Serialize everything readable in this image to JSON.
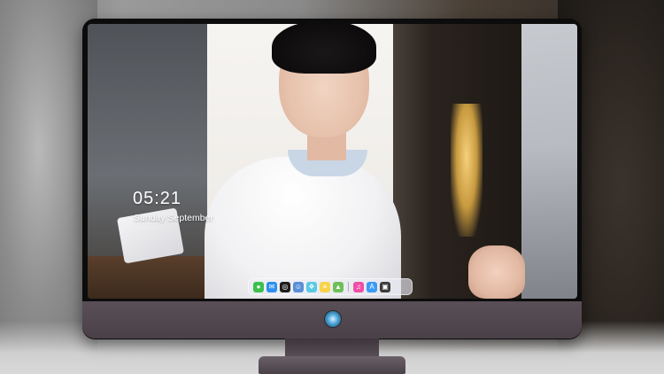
{
  "lock_screen": {
    "time": "05:21",
    "date": "Sunday September",
    "subtitle": "········ ········"
  },
  "dock": {
    "apps": [
      {
        "id": "messages",
        "icon": "messages-icon",
        "color": "#3bc04b",
        "glyph": "●"
      },
      {
        "id": "mail",
        "icon": "mail-icon",
        "color": "#2d8ff0",
        "glyph": "✉"
      },
      {
        "id": "safari",
        "icon": "safari-icon",
        "color": "#1c1c1c",
        "glyph": "◎"
      },
      {
        "id": "finder",
        "icon": "finder-icon",
        "color": "#5a8fd6",
        "glyph": "☺"
      },
      {
        "id": "photos",
        "icon": "photos-icon",
        "color": "#59c9e6",
        "glyph": "❖"
      },
      {
        "id": "notes",
        "icon": "notes-icon",
        "color": "#f6d34a",
        "glyph": "≡"
      },
      {
        "id": "maps",
        "icon": "maps-icon",
        "color": "#6fbf58",
        "glyph": "▲"
      },
      {
        "id": "music",
        "icon": "music-icon",
        "color": "#f04fa6",
        "glyph": "♫"
      },
      {
        "id": "app-store",
        "icon": "app-store-icon",
        "color": "#3a9cf5",
        "glyph": "A"
      },
      {
        "id": "camera",
        "icon": "camera-icon",
        "color": "#3a3a3a",
        "glyph": "▣"
      }
    ]
  },
  "monitor": {
    "logo_icon": "brand-logo-icon"
  }
}
